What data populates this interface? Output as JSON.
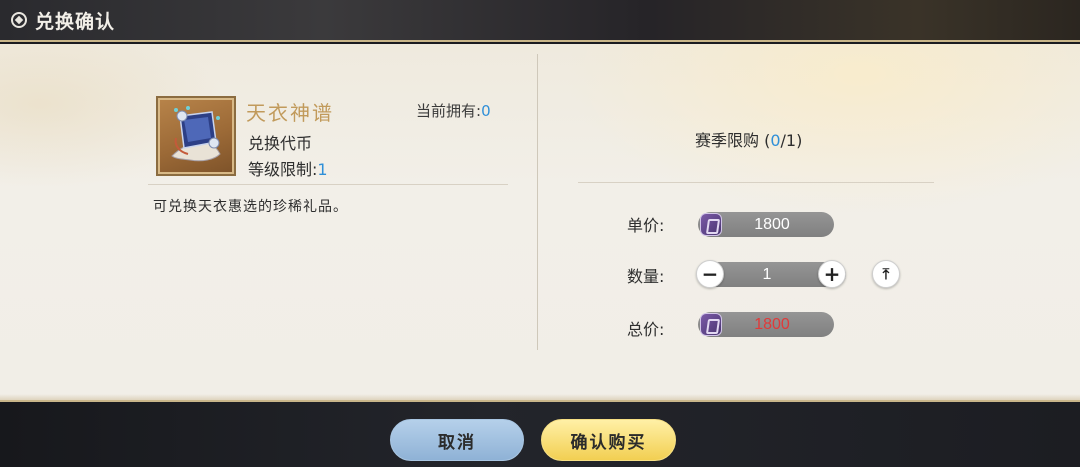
{
  "window": {
    "title": "兑换确认"
  },
  "item": {
    "name": "天衣神谱",
    "owned_label": "当前拥有:",
    "owned_value": "0",
    "type": "兑换代币",
    "level_label": "等级限制:",
    "level_value": "1",
    "description": "可兑换天衣惠选的珍稀礼品。"
  },
  "purchase": {
    "limit_label": "赛季限购 (",
    "limit_current": "0",
    "limit_sep": "/",
    "limit_max": "1",
    "limit_close": ")",
    "unit_price_label": "单价:",
    "unit_price": "1800",
    "quantity_label": "数量:",
    "quantity": "1",
    "total_label": "总价:",
    "total_price": "1800",
    "currency_icon": "purple-token-icon",
    "minus_symbol": "−",
    "plus_symbol": "+",
    "max_symbol": "⤒"
  },
  "actions": {
    "cancel": "取消",
    "confirm": "确认购买"
  },
  "colors": {
    "accent_blue": "#2f8fd8",
    "price_red": "#e03a3a",
    "item_name_gold": "#c19a5b",
    "confirm_yellow": "#f2cf52",
    "cancel_blue": "#8fb2d6"
  }
}
